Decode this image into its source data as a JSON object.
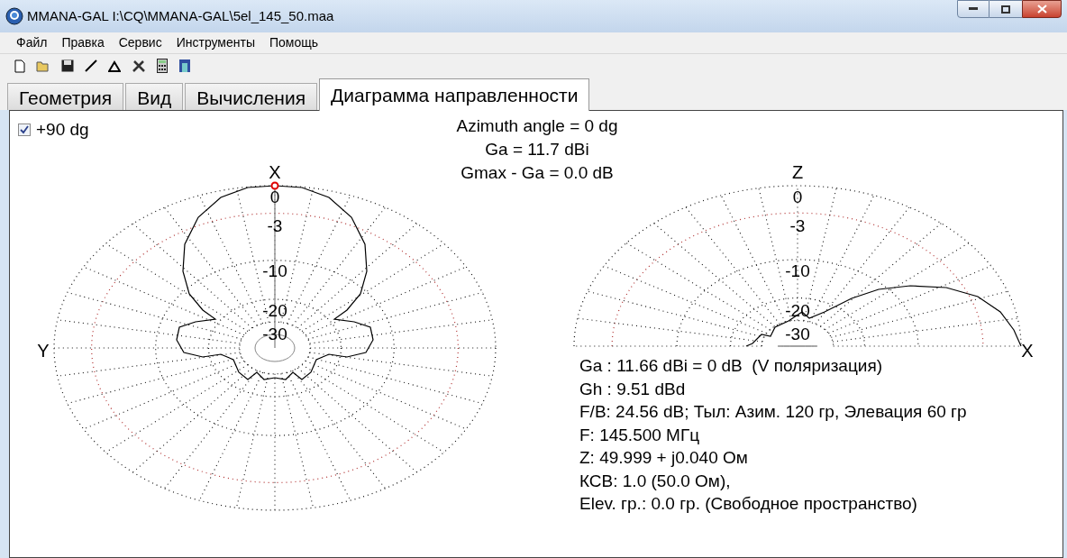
{
  "window": {
    "title": "MMANA-GAL I:\\CQ\\MMANA-GAL\\5el_145_50.maa"
  },
  "menu": [
    "Файл",
    "Правка",
    "Сервис",
    "Инструменты",
    "Помощь"
  ],
  "tabs": [
    {
      "label": "Геометрия",
      "selected": false
    },
    {
      "label": "Вид",
      "selected": false
    },
    {
      "label": "Вычисления",
      "selected": false
    },
    {
      "label": "Диаграмма направленности",
      "selected": true
    }
  ],
  "checkbox": {
    "label": "+90 dg",
    "checked": true
  },
  "header": [
    "Azimuth angle = 0 dg",
    "Ga = 11.7 dBi",
    "Gmax - Ga = 0.0 dB"
  ],
  "left_plot": {
    "axis_top": "X",
    "axis_side": "Y",
    "ring_labels": [
      "0",
      "-3",
      "-10",
      "-20",
      "-30"
    ]
  },
  "right_plot": {
    "axis_top": "Z",
    "axis_side": "X",
    "ring_labels": [
      "0",
      "-3",
      "-10",
      "-20",
      "-30"
    ]
  },
  "info": [
    "Ga : 11.66 dBi = 0 dB  (V поляризация)",
    "Gh : 9.51 dBd",
    "F/B: 24.56 dB; Тыл: Азим. 120 гр, Элевация 60 гр",
    "F: 145.500 МГц",
    "Z: 49.999 + j0.040 Ом",
    "КСВ: 1.0 (50.0 Ом),",
    "Elev. гр.: 0.0 гр. (Свободное пространство)"
  ]
}
